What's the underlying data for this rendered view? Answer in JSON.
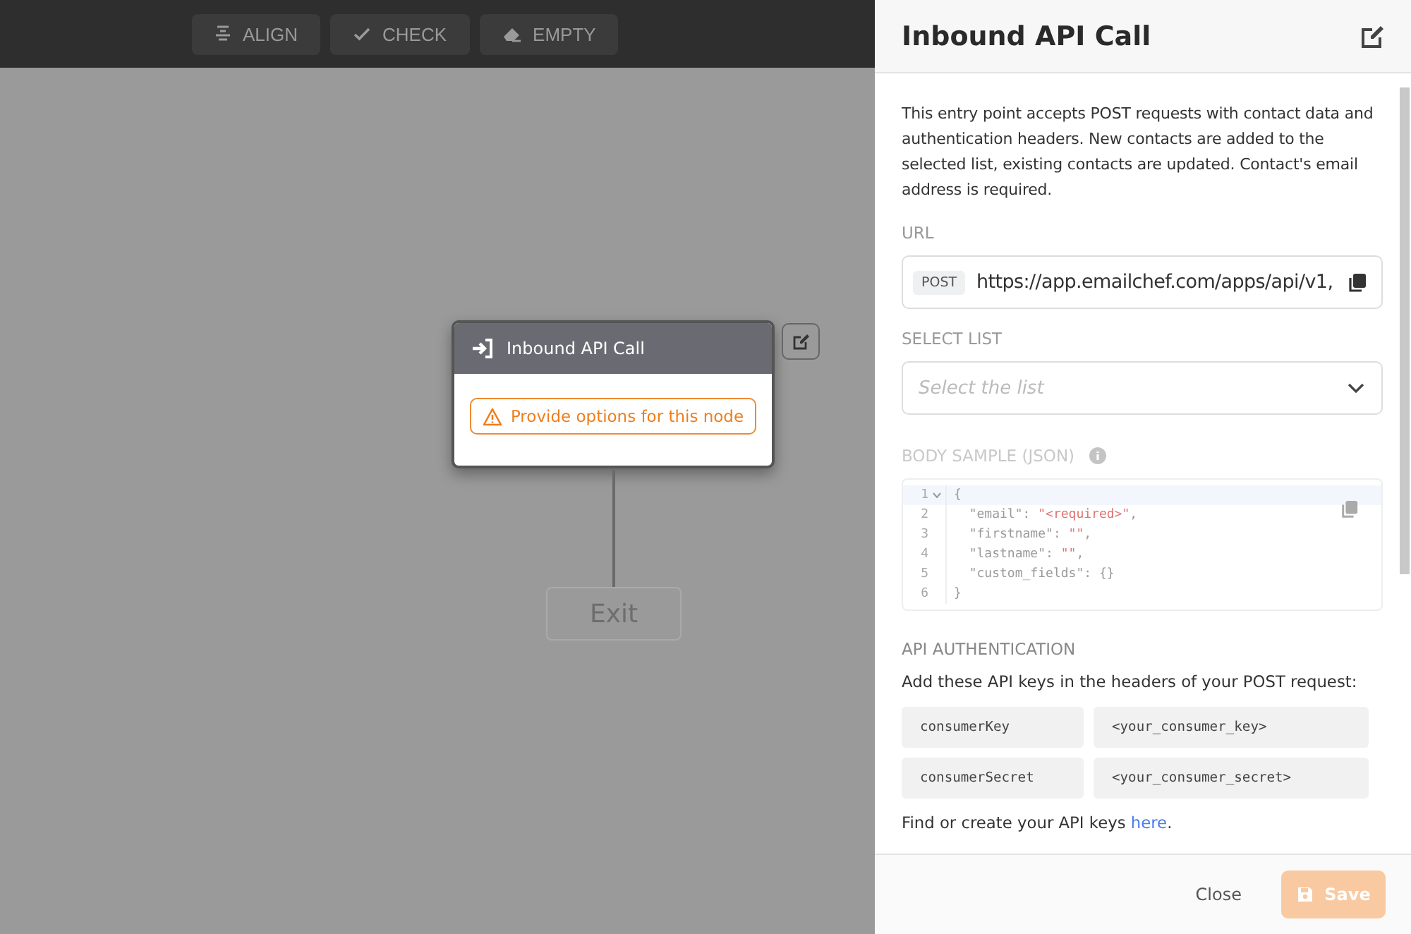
{
  "toolbar": [
    {
      "label": "ALIGN",
      "kind": "align"
    },
    {
      "label": "CHECK",
      "kind": "check"
    },
    {
      "label": "EMPTY",
      "kind": "eraser"
    }
  ],
  "node": {
    "title": "Inbound API Call",
    "warning": "Provide options for this node"
  },
  "exit_node": {
    "label": "Exit",
    "disabled": true
  },
  "panel": {
    "title": "Inbound API Call",
    "description": "This entry point accepts POST requests with contact data and authentication headers. New contacts are added to the selected list, existing contacts are updated. Contact's email address is required.",
    "url": {
      "label": "URL",
      "method": "POST",
      "value": "https://app.emailchef.com/apps/api/v1,"
    },
    "select_list": {
      "label": "SELECT LIST",
      "placeholder": "Select the list"
    },
    "body_sample": {
      "label": "BODY SAMPLE (JSON)",
      "lines": [
        {
          "number": "1",
          "active": true,
          "parts": [
            {
              "text": "{",
              "kind": "plain"
            }
          ]
        },
        {
          "number": "2",
          "active": false,
          "parts": [
            {
              "text": "  \"email\": ",
              "kind": "plain"
            },
            {
              "text": "\"<required>\"",
              "kind": "string"
            },
            {
              "text": ",",
              "kind": "plain"
            }
          ]
        },
        {
          "number": "3",
          "active": false,
          "parts": [
            {
              "text": "  \"firstname\": ",
              "kind": "plain"
            },
            {
              "text": "\"\"",
              "kind": "string"
            },
            {
              "text": ",",
              "kind": "plain"
            }
          ]
        },
        {
          "number": "4",
          "active": false,
          "parts": [
            {
              "text": "  \"lastname\": ",
              "kind": "plain"
            },
            {
              "text": "\"\"",
              "kind": "string"
            },
            {
              "text": ",",
              "kind": "plain"
            }
          ]
        },
        {
          "number": "5",
          "active": false,
          "parts": [
            {
              "text": "  \"custom_fields\": {}",
              "kind": "plain"
            }
          ]
        },
        {
          "number": "6",
          "active": false,
          "parts": [
            {
              "text": "}",
              "kind": "plain"
            }
          ]
        }
      ]
    },
    "auth": {
      "label": "API AUTHENTICATION",
      "intro": "Add these API keys in the headers of your POST request:",
      "keys": [
        {
          "name": "consumerKey",
          "value": "<your_consumer_key>"
        },
        {
          "name": "consumerSecret",
          "value": "<your_consumer_secret>"
        }
      ],
      "footer": {
        "before": "Find or create your API keys ",
        "link": "here",
        "after": "."
      }
    }
  },
  "footer": {
    "close": "Close",
    "save": {
      "label": "Save",
      "disabled": true
    }
  }
}
